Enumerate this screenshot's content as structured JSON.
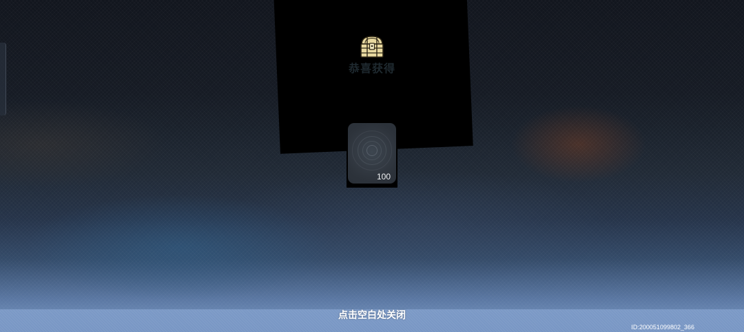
{
  "reward_popup": {
    "title": "恭喜获得",
    "chest_icon": "treasure-chest-icon",
    "items": [
      {
        "icon": "ripple-coin-icon",
        "quantity": "100"
      }
    ]
  },
  "footer": {
    "close_hint": "点击空白处关闭",
    "id_text": "ID:200051099802_366"
  },
  "colors": {
    "panel": "#000000",
    "chest_gold": "#e8d9a0",
    "hint_bar": "#7d9cc8",
    "title_text": "#1f2a30"
  }
}
